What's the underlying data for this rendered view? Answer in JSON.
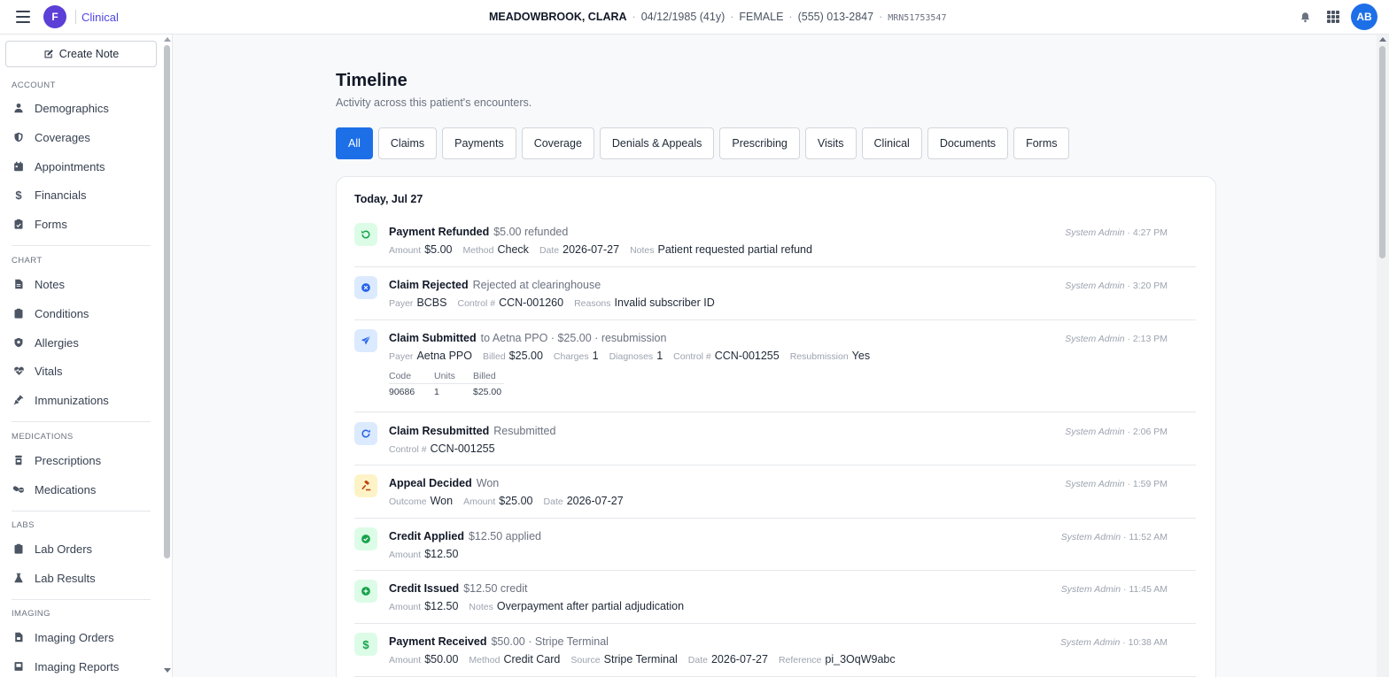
{
  "app": {
    "logo_letter": "F",
    "name": "Clinical",
    "user_initials": "AB"
  },
  "patient": {
    "name": "MEADOWBROOK, CLARA",
    "dob": "04/12/1985 (41y)",
    "sex": "FEMALE",
    "phone": "(555) 013-2847",
    "mrn": "MRN51753547"
  },
  "sidebar": {
    "create_note": "Create Note",
    "sections": [
      {
        "label": "ACCOUNT",
        "items": [
          "Demographics",
          "Coverages",
          "Appointments",
          "Financials",
          "Forms"
        ]
      },
      {
        "label": "CHART",
        "items": [
          "Notes",
          "Conditions",
          "Allergies",
          "Vitals",
          "Immunizations"
        ]
      },
      {
        "label": "MEDICATIONS",
        "items": [
          "Prescriptions",
          "Medications"
        ]
      },
      {
        "label": "LABS",
        "items": [
          "Lab Orders",
          "Lab Results"
        ]
      },
      {
        "label": "IMAGING",
        "items": [
          "Imaging Orders",
          "Imaging Reports"
        ]
      }
    ]
  },
  "page": {
    "title": "Timeline",
    "subtitle": "Activity across this patient's encounters."
  },
  "tabs": [
    "All",
    "Claims",
    "Payments",
    "Coverage",
    "Denials & Appeals",
    "Prescribing",
    "Visits",
    "Clinical",
    "Documents",
    "Forms"
  ],
  "active_tab": "All",
  "timeline": {
    "day_label": "Today, Jul 27",
    "events": [
      {
        "title": "Payment Refunded",
        "summary": "$5.00 refunded",
        "user": "System Admin",
        "time": "4:27 PM",
        "fields": [
          [
            "Amount",
            "$5.00"
          ],
          [
            "Method",
            "Check"
          ],
          [
            "Date",
            "2026-07-27"
          ],
          [
            "Notes",
            "Patient requested partial refund"
          ]
        ]
      },
      {
        "title": "Claim Rejected",
        "summary": "Rejected at clearinghouse",
        "user": "System Admin",
        "time": "3:20 PM",
        "fields": [
          [
            "Payer",
            "BCBS"
          ],
          [
            "Control #",
            "CCN-001260"
          ],
          [
            "Reasons",
            "Invalid subscriber ID"
          ]
        ]
      },
      {
        "title": "Claim Submitted",
        "summary": "to Aetna PPO · $25.00 · resubmission",
        "user": "System Admin",
        "time": "2:13 PM",
        "fields": [
          [
            "Payer",
            "Aetna PPO"
          ],
          [
            "Billed",
            "$25.00"
          ],
          [
            "Charges",
            "1"
          ],
          [
            "Diagnoses",
            "1"
          ],
          [
            "Control #",
            "CCN-001255"
          ],
          [
            "Resubmission",
            "Yes"
          ]
        ],
        "table": {
          "headers": [
            "Code",
            "Units",
            "Billed"
          ],
          "row": [
            "90686",
            "1",
            "$25.00"
          ]
        }
      },
      {
        "title": "Claim Resubmitted",
        "summary": "Resubmitted",
        "user": "System Admin",
        "time": "2:06 PM",
        "fields": [
          [
            "Control #",
            "CCN-001255"
          ]
        ]
      },
      {
        "title": "Appeal Decided",
        "summary": "Won",
        "user": "System Admin",
        "time": "1:59 PM",
        "fields": [
          [
            "Outcome",
            "Won"
          ],
          [
            "Amount",
            "$25.00"
          ],
          [
            "Date",
            "2026-07-27"
          ]
        ]
      },
      {
        "title": "Credit Applied",
        "summary": "$12.50 applied",
        "user": "System Admin",
        "time": "11:52 AM",
        "fields": [
          [
            "Amount",
            "$12.50"
          ]
        ]
      },
      {
        "title": "Credit Issued",
        "summary": "$12.50 credit",
        "user": "System Admin",
        "time": "11:45 AM",
        "fields": [
          [
            "Amount",
            "$12.50"
          ],
          [
            "Notes",
            "Overpayment after partial adjudication"
          ]
        ]
      },
      {
        "title": "Payment Received",
        "summary": "$50.00 · Stripe Terminal",
        "user": "System Admin",
        "time": "10:38 AM",
        "fields": [
          [
            "Amount",
            "$50.00"
          ],
          [
            "Method",
            "Credit Card"
          ],
          [
            "Source",
            "Stripe Terminal"
          ],
          [
            "Date",
            "2026-07-27"
          ],
          [
            "Reference",
            "pi_3OqW9abc"
          ]
        ]
      }
    ]
  },
  "colors": {
    "accent": "#1d6fe8",
    "brand": "#5b3fd6",
    "green": "#16a34a",
    "blue": "#2563eb",
    "amber": "#c2410c"
  }
}
